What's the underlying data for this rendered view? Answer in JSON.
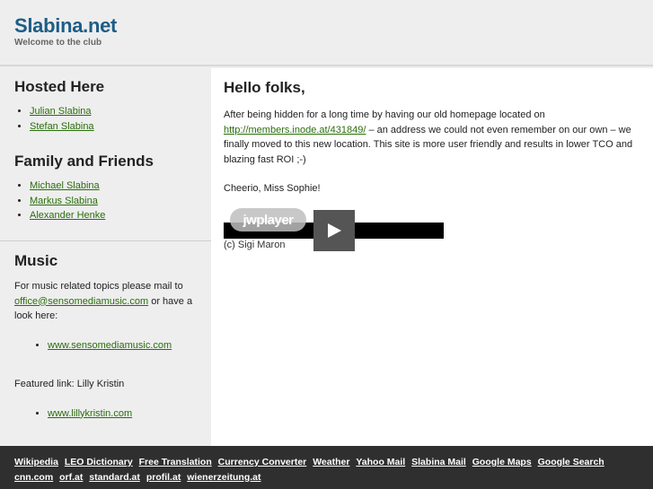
{
  "header": {
    "title": "Slabina.net",
    "subtitle": "Welcome to the club"
  },
  "sidebar": {
    "hosted": {
      "heading": "Hosted Here",
      "links": [
        "Julian Slabina",
        "Stefan Slabina"
      ]
    },
    "family": {
      "heading": "Family and Friends",
      "links": [
        "Michael Slabina",
        "Markus Slabina",
        "Alexander Henke"
      ]
    },
    "music": {
      "heading": "Music",
      "text_before": "For music related topics please mail to ",
      "email": "office@sensomediamusic.com",
      "text_after": " or have a look here:",
      "link": "www.sensomediamusic.com",
      "featured_label": "Featured link: Lilly Kristin",
      "featured_link": "www.lillykristin.com"
    }
  },
  "main": {
    "heading": "Hello folks,",
    "para_before": "After being hidden for a long time by having our old homepage located on ",
    "old_url": "http://members.inode.at/431849/",
    "para_after": " – an address we could not even remember on our own – we finally moved to this new location. This site is more user friendly and results in lower TCO and blazing fast ROI ;-)",
    "signoff": "Cheerio, Miss Sophie!",
    "player_logo": "jwplayer",
    "credit": "(c) Sigi Maron"
  },
  "footer": {
    "links": [
      "Wikipedia",
      "LEO Dictionary",
      "Free Translation",
      "Currency Converter",
      "Weather",
      "Yahoo Mail",
      "Slabina Mail",
      "Google Maps",
      "Google Search",
      "cnn.com",
      "orf.at",
      "standard.at",
      "profil.at",
      "wienerzeitung.at"
    ]
  },
  "colors": {
    "title": "#1d5d86",
    "link": "#2a6e0c",
    "footer_bg": "#2f2f2f",
    "sidebar_bg": "#eeeeee"
  },
  "icons": {
    "play": "play-icon"
  }
}
